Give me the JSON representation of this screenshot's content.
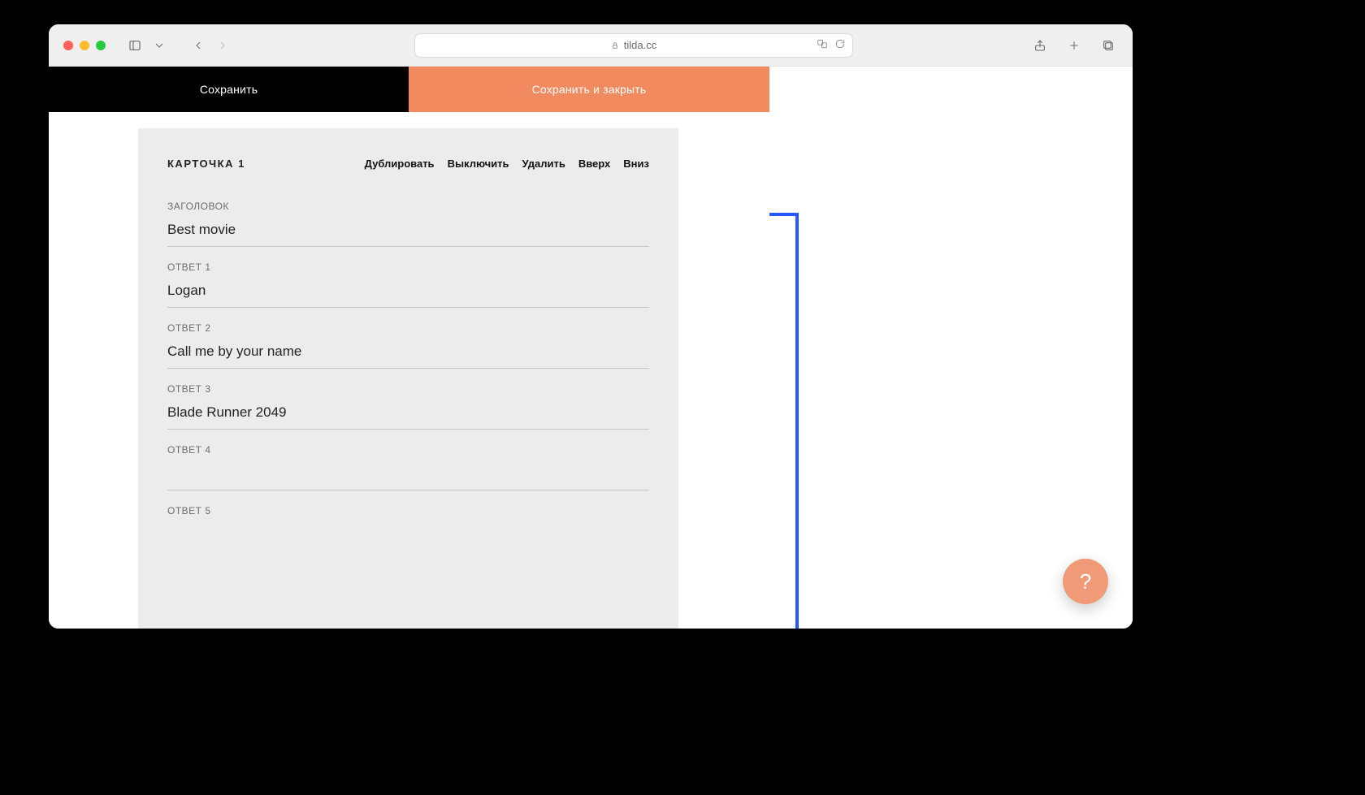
{
  "browser": {
    "url_host": "tilda.cc"
  },
  "toolbar": {
    "save_label": "Сохранить",
    "save_close_label": "Сохранить и закрыть"
  },
  "card": {
    "title": "КАРТОЧКА 1",
    "actions": {
      "duplicate": "Дублировать",
      "disable": "Выключить",
      "delete": "Удалить",
      "up": "Вверх",
      "down": "Вниз"
    },
    "fields": {
      "heading_label": "ЗАГОЛОВОК",
      "heading_value": "Best movie",
      "answer1_label": "ОТВЕТ 1",
      "answer1_value": "Logan",
      "answer2_label": "ОТВЕТ 2",
      "answer2_value": "Call me by your name",
      "answer3_label": "ОТВЕТ 3",
      "answer3_value": "Blade Runner 2049",
      "answer4_label": "ОТВЕТ 4",
      "answer4_value": "",
      "answer5_label": "ОТВЕТ 5",
      "answer5_value": ""
    }
  },
  "help": {
    "glyph": "?"
  }
}
